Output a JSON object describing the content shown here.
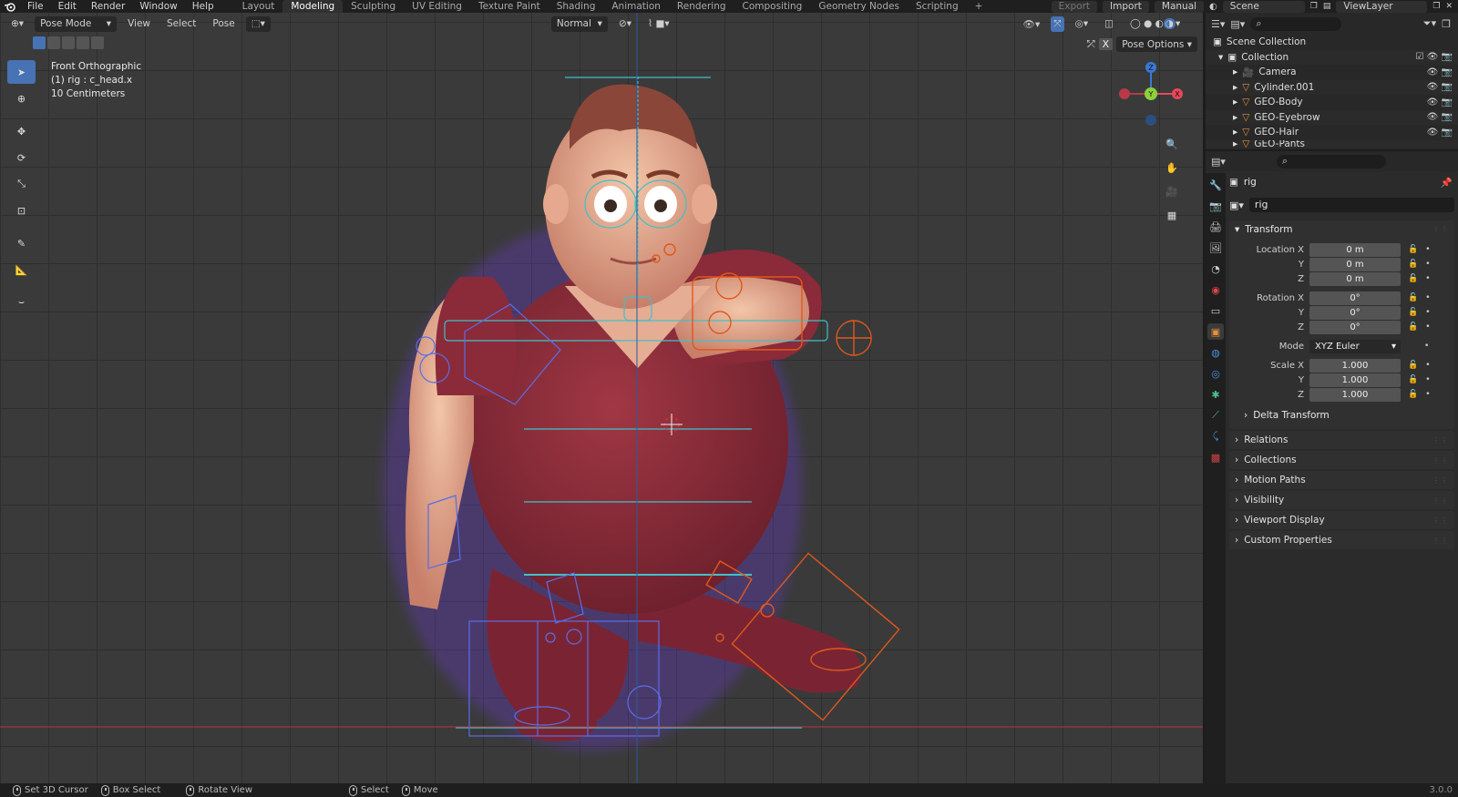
{
  "menu": {
    "items": [
      "File",
      "Edit",
      "Render",
      "Window",
      "Help"
    ]
  },
  "workspaces": {
    "tabs": [
      "Layout",
      "Modeling",
      "Sculpting",
      "UV Editing",
      "Texture Paint",
      "Shading",
      "Animation",
      "Rendering",
      "Compositing",
      "Geometry Nodes",
      "Scripting"
    ],
    "active": "Modeling"
  },
  "topright": {
    "export": "Export",
    "import": "Import",
    "manual": "Manual",
    "scene": "Scene",
    "viewlayer": "ViewLayer"
  },
  "viewport": {
    "mode": "Pose Mode",
    "menus": [
      "View",
      "Select",
      "Pose"
    ],
    "orientation": "Normal",
    "pose_options": "Pose Options",
    "x_label": "X",
    "info": {
      "view": "Front Orthographic",
      "object": "(1) rig : c_head.x",
      "scale": "10 Centimeters"
    },
    "gizmo": {
      "x": "X",
      "y": "Y",
      "z": "Z"
    }
  },
  "outliner": {
    "root": "Scene Collection",
    "collection": "Collection",
    "items": [
      "Camera",
      "Cylinder.001",
      "GEO-Body",
      "GEO-Eyebrow",
      "GEO-Hair",
      "GEO-Pants"
    ]
  },
  "properties": {
    "object_name": "rig",
    "name_field": "rig",
    "transform": {
      "title": "Transform",
      "location_label": "Location X",
      "location": [
        "0 m",
        "0 m",
        "0 m"
      ],
      "rotation_label": "Rotation X",
      "rotation": [
        "0°",
        "0°",
        "0°"
      ],
      "mode_label": "Mode",
      "mode": "XYZ Euler",
      "scale_label": "Scale X",
      "scale": [
        "1.000",
        "1.000",
        "1.000"
      ],
      "y_label": "Y",
      "z_label": "Z",
      "delta": "Delta Transform"
    },
    "panels": [
      "Relations",
      "Collections",
      "Motion Paths",
      "Visibility",
      "Viewport Display",
      "Custom Properties"
    ]
  },
  "status": {
    "items": [
      "Set 3D Cursor",
      "Box Select",
      "Rotate View",
      "Select",
      "Move"
    ],
    "version": "3.0.0"
  },
  "colors": {
    "accent": "#4772b3",
    "rig_cyan": "#3fc1c9",
    "rig_orange": "#e0581c",
    "rig_blue": "#5a6de8",
    "shirt": "#8a2c3a"
  }
}
